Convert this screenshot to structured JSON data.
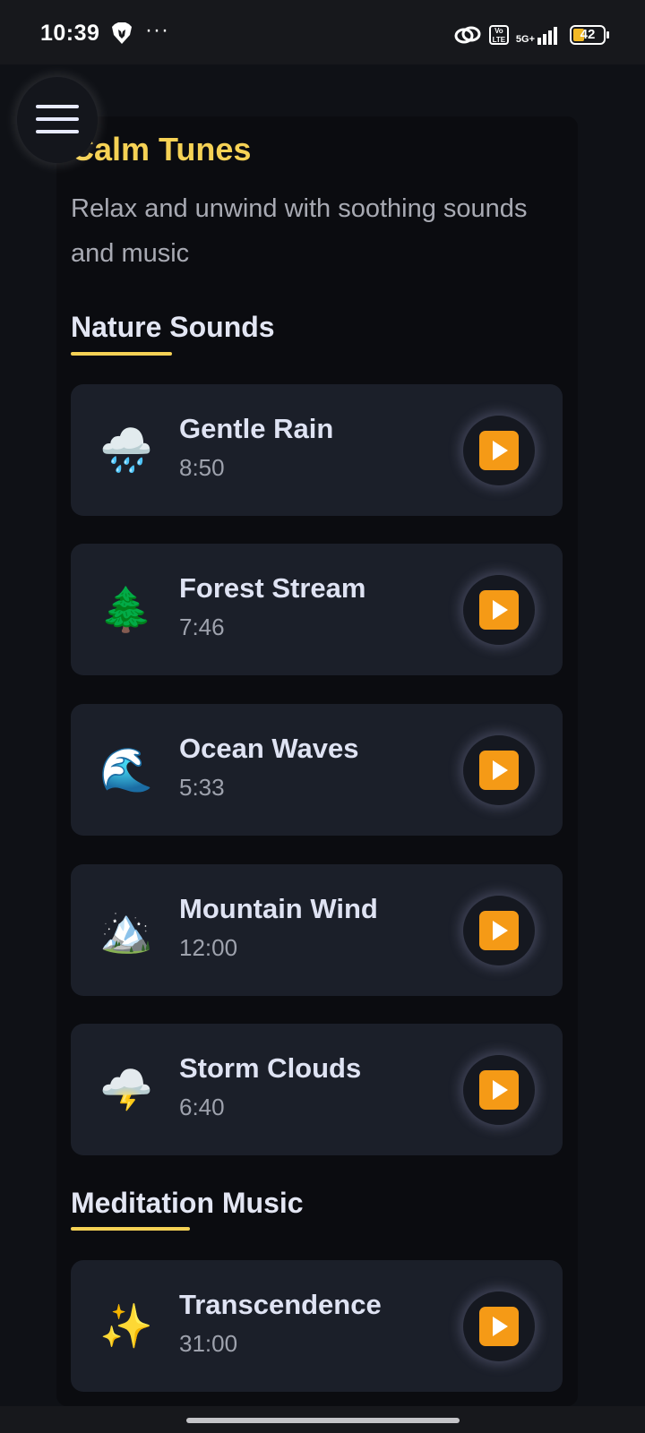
{
  "status_bar": {
    "time": "10:39",
    "dots": "···",
    "brave_icon": "brave-lion-icon",
    "volte": "Vo LTE",
    "network": "5G+",
    "battery": "42"
  },
  "header": {
    "title": "Calm Tunes",
    "subtitle": "Relax and unwind with soothing sounds and music",
    "menu_icon": "hamburger-menu-icon"
  },
  "sections": [
    {
      "title": "Nature Sounds",
      "tracks": [
        {
          "emoji": "🌧️",
          "icon": "rain-cloud-icon",
          "name": "Gentle Rain",
          "duration": "8:50"
        },
        {
          "emoji": "🌲",
          "icon": "evergreen-tree-icon",
          "name": "Forest Stream",
          "duration": "7:46"
        },
        {
          "emoji": "🌊",
          "icon": "ocean-wave-icon",
          "name": "Ocean Waves",
          "duration": "5:33"
        },
        {
          "emoji": "🏔️",
          "icon": "snow-mountain-icon",
          "name": "Mountain Wind",
          "duration": "12:00"
        },
        {
          "emoji": "🌩️",
          "icon": "thunder-cloud-icon",
          "name": "Storm Clouds",
          "duration": "6:40"
        }
      ]
    },
    {
      "title": "Meditation Music",
      "tracks": [
        {
          "emoji": "✨",
          "icon": "sparkles-icon",
          "name": "Transcendence",
          "duration": "31:00"
        }
      ]
    }
  ],
  "colors": {
    "accent": "#f6d255",
    "play": "#f59a16",
    "card": "#1b1f29",
    "background": "#0f1116"
  }
}
